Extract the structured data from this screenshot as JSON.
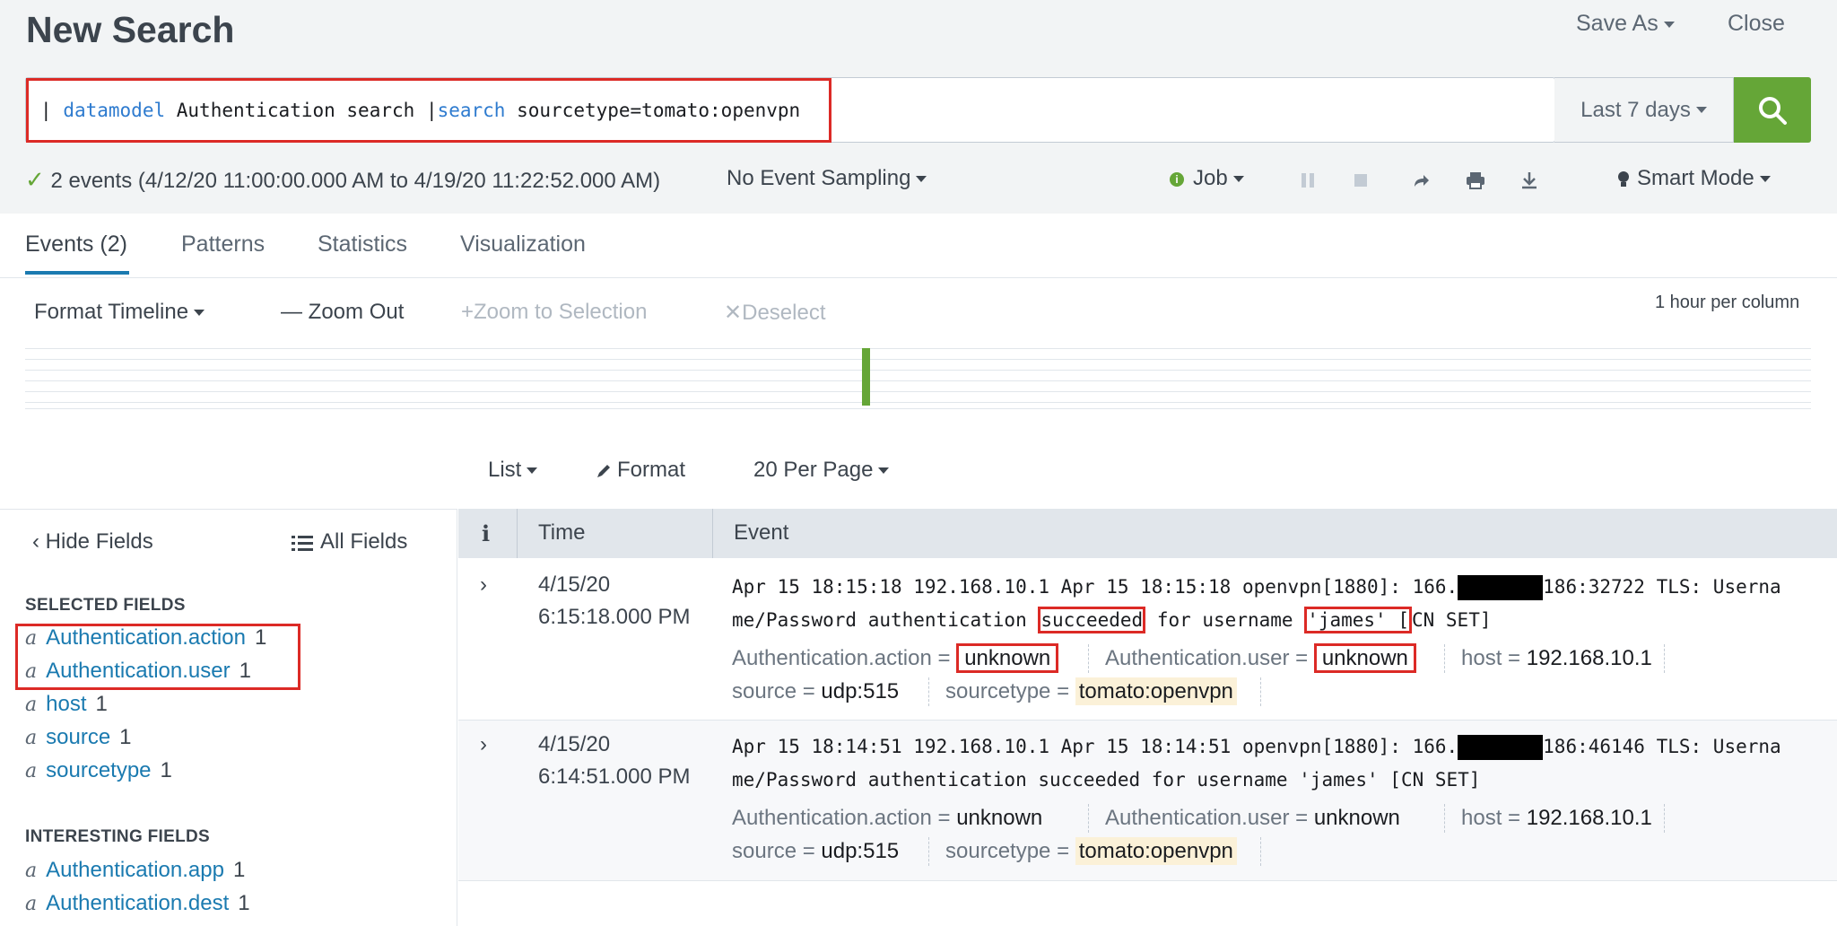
{
  "header": {
    "title": "New Search",
    "save_as": "Save As",
    "close": "Close"
  },
  "search": {
    "pipe1": "|",
    "kw1": "datamodel",
    "text1": "Authentication search",
    "pipe2": "|",
    "kw2": "search",
    "text2": "sourcetype=tomato:openvpn",
    "time_range": "Last 7 days"
  },
  "status": {
    "events_summary": "2 events (4/12/20 11:00:00.000 AM to 4/19/20 11:22:52.000 AM)",
    "sampling": "No Event Sampling",
    "job": "Job",
    "mode": "Smart Mode"
  },
  "tabs": [
    {
      "label": "Events (2)"
    },
    {
      "label": "Patterns"
    },
    {
      "label": "Statistics"
    },
    {
      "label": "Visualization"
    }
  ],
  "timeline": {
    "format": "Format Timeline",
    "zoom_out": "Zoom Out",
    "zoom_sel": "Zoom to Selection",
    "deselect": "Deselect",
    "scale": "1 hour per column"
  },
  "list_controls": {
    "list": "List",
    "format": "Format",
    "per_page": "20 Per Page"
  },
  "sidebar": {
    "hide_fields": "Hide Fields",
    "all_fields": "All Fields",
    "selected_label": "SELECTED FIELDS",
    "selected": [
      {
        "name": "Authentication.action",
        "count": "1"
      },
      {
        "name": "Authentication.user",
        "count": "1"
      },
      {
        "name": "host",
        "count": "1"
      },
      {
        "name": "source",
        "count": "1"
      },
      {
        "name": "sourcetype",
        "count": "1"
      }
    ],
    "interesting_label": "INTERESTING FIELDS",
    "interesting": [
      {
        "name": "Authentication.app",
        "count": "1"
      },
      {
        "name": "Authentication.dest",
        "count": "1"
      }
    ]
  },
  "table": {
    "col_i": "i",
    "col_time": "Time",
    "col_event": "Event",
    "events": [
      {
        "date": "4/15/20",
        "time": "6:15:18.000 PM",
        "line1_a": "Apr 15 18:15:18 192.168.10.1 Apr 15 18:15:18 openvpn[1880]: 166.",
        "line1_b": "186:32722 TLS: Userna",
        "line2_a": "me/Password authentication ",
        "line2_succ": "succeeded",
        "line2_b": " for username ",
        "line2_user": "'james' [",
        "line2_c": "CN SET]",
        "action_k": "Authentication.action =",
        "action_v": "unknown",
        "user_k": "Authentication.user =",
        "user_v": "unknown",
        "host_k": "host =",
        "host_v": "192.168.10.1",
        "source_k": "source =",
        "source_v": "udp:515",
        "st_k": "sourcetype =",
        "st_v": "tomato:openvpn"
      },
      {
        "date": "4/15/20",
        "time": "6:14:51.000 PM",
        "line1_a": "Apr 15 18:14:51 192.168.10.1 Apr 15 18:14:51 openvpn[1880]: 166.",
        "line1_b": "186:46146 TLS: Userna",
        "line2": "me/Password authentication succeeded for username 'james' [CN SET]",
        "action_k": "Authentication.action =",
        "action_v": "unknown",
        "user_k": "Authentication.user =",
        "user_v": "unknown",
        "host_k": "host =",
        "host_v": "192.168.10.1",
        "source_k": "source =",
        "source_v": "udp:515",
        "st_k": "sourcetype =",
        "st_v": "tomato:openvpn"
      }
    ]
  },
  "colors": {
    "accent_green": "#65a637",
    "link_blue": "#1a7ab0",
    "highlight_red": "#dc2a26"
  }
}
